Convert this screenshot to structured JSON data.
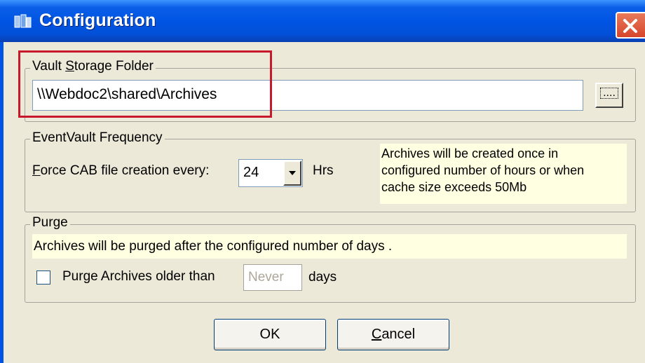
{
  "window": {
    "title": "Configuration",
    "icon": "app-icon",
    "close_icon": "close-icon"
  },
  "vault": {
    "legend_prefix": "Vault ",
    "legend_access": "S",
    "legend_suffix": "torage Folder",
    "path_value": "\\\\Webdoc2\\shared\\Archives",
    "browse_label": "...."
  },
  "frequency": {
    "legend": "EventVault Frequency",
    "label_access": "F",
    "label_rest": "orce CAB file creation every:",
    "selected_hours": "24",
    "unit": "Hrs",
    "note_lines": [
      "Archives will be created once in",
      "configured number of hours or when",
      "cache size exceeds 50Mb"
    ]
  },
  "purge": {
    "legend": "Purge",
    "note": "Archives will be purged after the configured number of days .",
    "checkbox_label": "Purge Archives older than",
    "checked": false,
    "days_value": "Never",
    "days_unit": "days"
  },
  "buttons": {
    "ok": "OK",
    "cancel_access": "C",
    "cancel_rest": "ancel"
  },
  "colors": {
    "title_bar": "#0054e3",
    "highlight": "#c8182b",
    "note_bg": "#ffffe1",
    "dialog_bg": "#ece9d8"
  }
}
